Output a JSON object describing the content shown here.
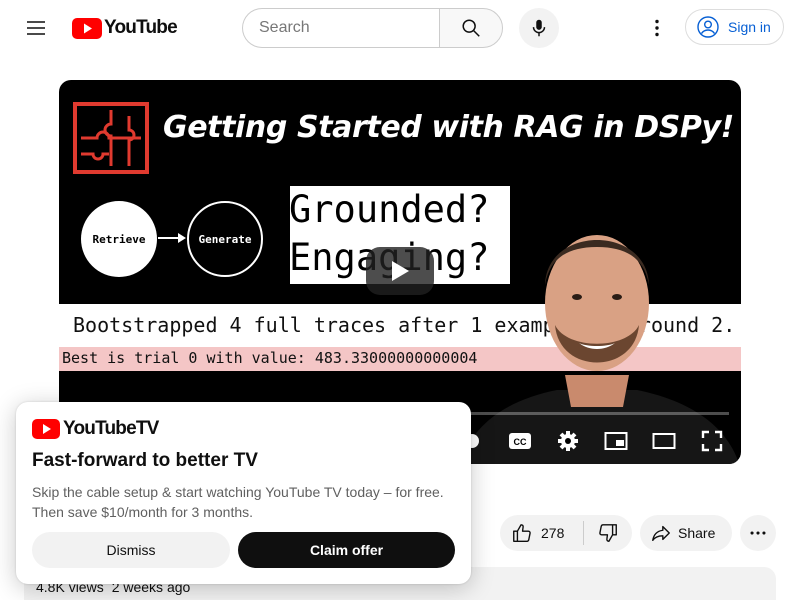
{
  "header": {
    "logo_text": "YouTube",
    "search_placeholder": "Search",
    "signin_label": "Sign in"
  },
  "player": {
    "thumb_title": "Getting Started with RAG in DSPy!",
    "node_retrieve": "Retrieve",
    "node_generate": "Generate",
    "grounded_line1": "Grounded?",
    "grounded_line2": "Engaging?",
    "log_line1": "Bootstrapped 4 full traces after 1 examples in round 2.",
    "log_line2": "Best is trial 0 with value: 483.33000000000004"
  },
  "promo": {
    "logo_text": "YouTubeTV",
    "title": "Fast-forward to better TV",
    "description": "Skip the cable setup & start watching YouTube TV today – for free. Then save $10/month for 3 months.",
    "dismiss_label": "Dismiss",
    "claim_label": "Claim offer"
  },
  "actions": {
    "like_count": "278",
    "share_label": "Share"
  },
  "meta": {
    "views": "4.8K views",
    "age": "2 weeks ago"
  },
  "colors": {
    "brand_red": "#ff0000",
    "link_blue": "#065fd4",
    "puzzle_red": "#e03a2f",
    "log_highlight": "#f4c6c6"
  }
}
